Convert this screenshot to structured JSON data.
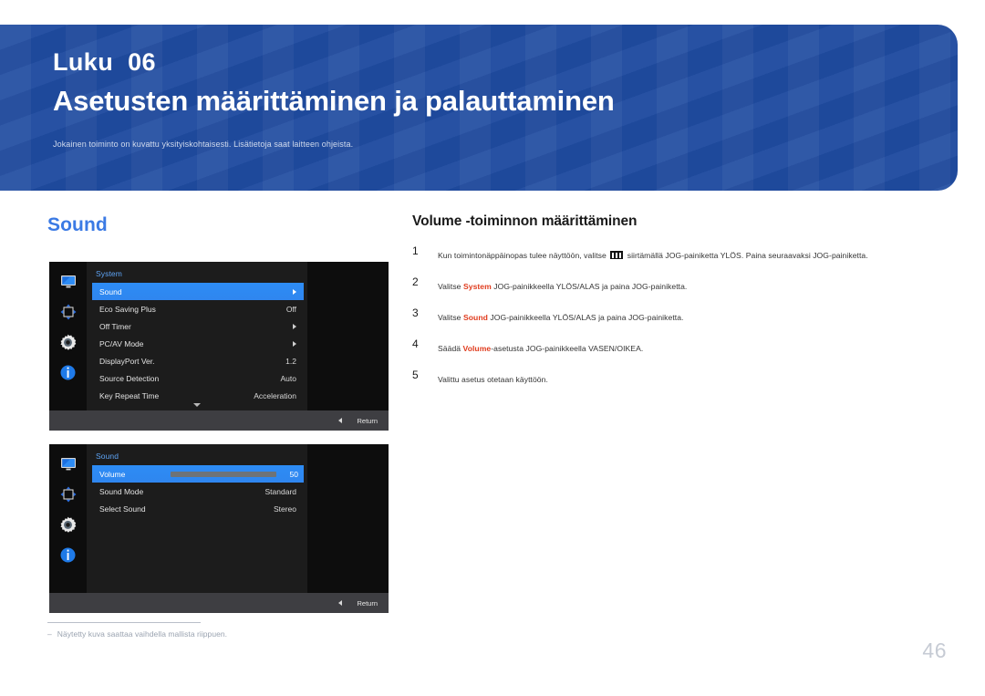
{
  "banner": {
    "chapter_label": "Luku",
    "chapter_number": "06",
    "title": "Asetusten määrittäminen ja palauttaminen",
    "subtitle": "Jokainen toiminto on kuvattu yksityiskohtaisesti. Lisätietoja saat laitteen ohjeista.",
    "bg_color": "#1f4ba0"
  },
  "left": {
    "section_heading": "Sound",
    "section_heading_color": "#3b7ae4",
    "footnote_dash": "‒",
    "footnote_text": "Näytetty kuva saattaa vaihdella mallista riippuen."
  },
  "osd1": {
    "title": "System",
    "sidebar_icons": [
      {
        "name": "display-icon",
        "label": "Picture"
      },
      {
        "name": "picture-position-icon",
        "label": "OnScreen Display"
      },
      {
        "name": "gear-icon",
        "label": "System"
      },
      {
        "name": "info-icon",
        "label": "Information"
      }
    ],
    "rows": [
      {
        "label": "Sound",
        "value": "",
        "kind": "arrow",
        "selected": true
      },
      {
        "label": "Eco Saving Plus",
        "value": "Off",
        "kind": "value",
        "selected": false
      },
      {
        "label": "Off Timer",
        "value": "",
        "kind": "arrow",
        "selected": false
      },
      {
        "label": "PC/AV Mode",
        "value": "",
        "kind": "arrow",
        "selected": false
      },
      {
        "label": "DisplayPort Ver.",
        "value": "1.2",
        "kind": "value",
        "selected": false
      },
      {
        "label": "Source Detection",
        "value": "Auto",
        "kind": "value",
        "selected": false
      },
      {
        "label": "Key Repeat Time",
        "value": "Acceleration",
        "kind": "value",
        "selected": false
      }
    ],
    "has_scroll_down": true,
    "footer_label": "Return"
  },
  "osd2": {
    "title": "Sound",
    "sidebar_icons": [
      {
        "name": "display-icon",
        "label": "Picture"
      },
      {
        "name": "picture-position-icon",
        "label": "OnScreen Display"
      },
      {
        "name": "gear-icon",
        "label": "System"
      },
      {
        "name": "info-icon",
        "label": "Information"
      }
    ],
    "rows": [
      {
        "label": "Volume",
        "value": "50",
        "kind": "slider",
        "selected": true,
        "slider_percent": 50
      },
      {
        "label": "Sound Mode",
        "value": "Standard",
        "kind": "value",
        "selected": false
      },
      {
        "label": "Select Sound",
        "value": "Stereo",
        "kind": "value",
        "selected": false
      }
    ],
    "has_scroll_down": false,
    "footer_label": "Return"
  },
  "right": {
    "procedure_title": "Volume -toiminnon määrittäminen",
    "steps": [
      {
        "num": "1",
        "parts": [
          {
            "t": "text",
            "v": "Kun toimintonäppäinopas tulee näyttöön, valitse "
          },
          {
            "t": "glyph",
            "v": "menu-icon"
          },
          {
            "t": "text",
            "v": " siirtämällä JOG-painiketta YLÖS. Paina seuraavaksi JOG-painiketta."
          }
        ]
      },
      {
        "num": "2",
        "parts": [
          {
            "t": "text",
            "v": "Valitse "
          },
          {
            "t": "hl",
            "v": "System"
          },
          {
            "t": "text",
            "v": " JOG-painikkeella YLÖS/ALAS ja paina JOG-painiketta."
          }
        ]
      },
      {
        "num": "3",
        "parts": [
          {
            "t": "text",
            "v": "Valitse "
          },
          {
            "t": "hl",
            "v": "Sound"
          },
          {
            "t": "text",
            "v": " JOG-painikkeella YLÖS/ALAS ja paina JOG-painiketta."
          }
        ]
      },
      {
        "num": "4",
        "parts": [
          {
            "t": "text",
            "v": "Säädä "
          },
          {
            "t": "hl",
            "v": "Volume"
          },
          {
            "t": "text",
            "v": "-asetusta JOG-painikkeella VASEN/OIKEA."
          }
        ]
      },
      {
        "num": "5",
        "parts": [
          {
            "t": "text",
            "v": "Valittu asetus otetaan käyttöön."
          }
        ]
      }
    ],
    "highlight_color": "#e03c1e"
  },
  "page_number": "46"
}
